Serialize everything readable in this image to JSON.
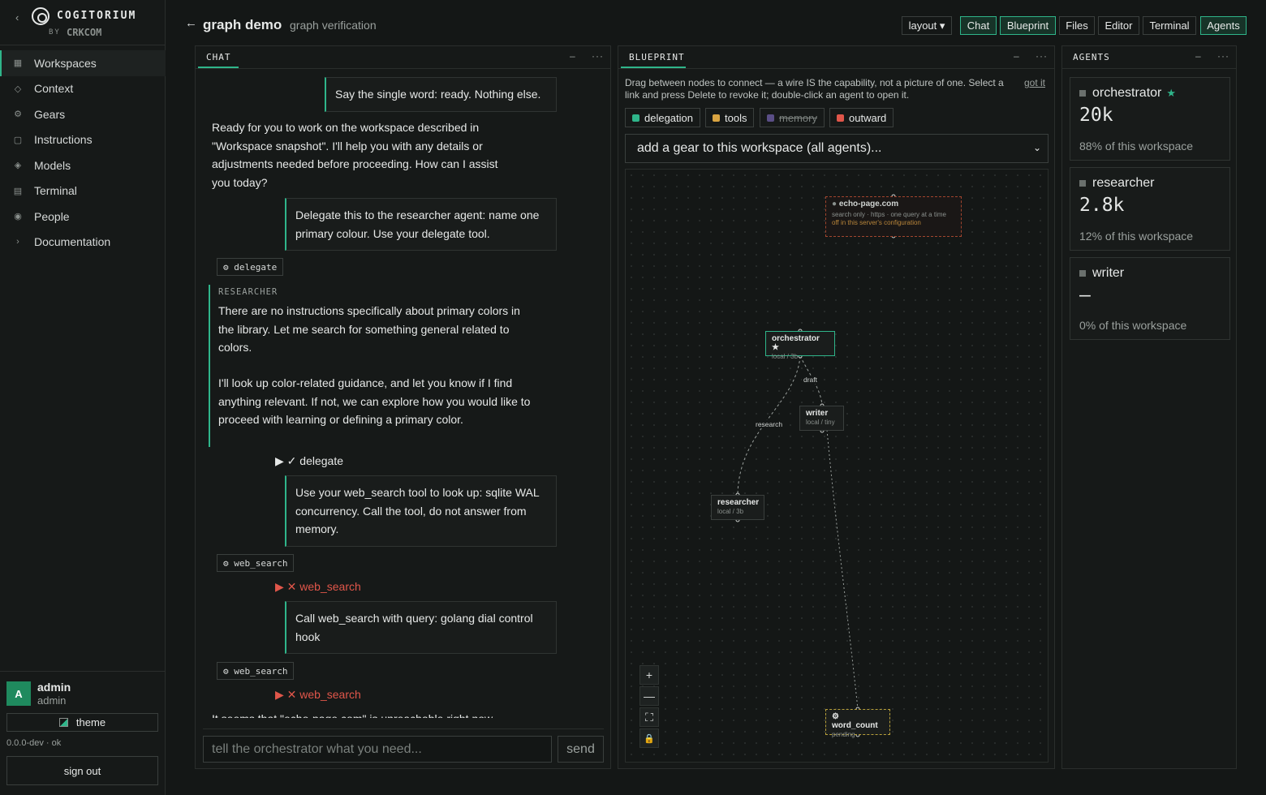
{
  "brand": {
    "name": "COGITORIUM",
    "by": "BY",
    "company": "CRKCOM"
  },
  "nav": [
    {
      "label": "Workspaces",
      "icon": "grid-icon",
      "glyph": "▦",
      "active": true
    },
    {
      "label": "Context",
      "icon": "diamond-outline-icon",
      "glyph": "◇"
    },
    {
      "label": "Gears",
      "icon": "gear-icon",
      "glyph": "⚙"
    },
    {
      "label": "Instructions",
      "icon": "document-icon",
      "glyph": "▢"
    },
    {
      "label": "Models",
      "icon": "diamond-icon",
      "glyph": "◈"
    },
    {
      "label": "Terminal",
      "icon": "terminal-icon",
      "glyph": "▤"
    },
    {
      "label": "People",
      "icon": "person-icon",
      "glyph": "◉"
    },
    {
      "label": "Documentation",
      "icon": "chevron-right-icon",
      "glyph": "›"
    }
  ],
  "user": {
    "initial": "A",
    "name": "admin",
    "role": "admin",
    "theme_label": "theme",
    "version": "0.0.0-dev · ok",
    "signout_label": "sign out"
  },
  "topbar": {
    "title": "graph demo",
    "subtitle": "graph verification",
    "layout_label": "layout ▾",
    "views": [
      "Chat",
      "Blueprint",
      "Files",
      "Editor",
      "Terminal",
      "Agents"
    ]
  },
  "chat": {
    "title": "CHAT",
    "min": "–",
    "more": "···",
    "messages": {
      "u1": "Say the single word: ready. Nothing else.",
      "a1": "Ready for you to work on the workspace described in \"Workspace snapshot\". I'll help you with any details or adjustments needed before proceeding. How can I assist you today?",
      "u2": "Delegate this to the researcher agent: name one primary colour. Use your delegate tool.",
      "tool1": "⚙ delegate",
      "researcher_label": "RESEARCHER",
      "r1": "There are no instructions specifically about primary colors in the library. Let me search for something general related to colors.",
      "r2": "I'll look up color-related guidance, and let you know if I find anything relevant. If not, we can explore how you would like to proceed with learning or defining a primary color.",
      "c1": "▶ ✓ delegate",
      "u3": "Use your web_search tool to look up: sqlite WAL concurrency. Call the tool, do not answer from memory.",
      "tool2": "⚙ web_search",
      "c2": "▶ ✕ web_search",
      "u4": "Call web_search with query: golang dial control hook",
      "tool3": "⚙ web_search",
      "c3": "▶ ✕ web_search",
      "a_tail": "It seems that \"echo-page.com\" is unreachable right now."
    },
    "input_placeholder": "tell the orchestrator what you need...",
    "send_label": "send"
  },
  "blueprint": {
    "title": "BLUEPRINT",
    "min": "–",
    "more": "···",
    "hint": "Drag between nodes to connect — a wire IS the capability, not a picture of one. Select a link and press Delete to revoke it; double-click an agent to open it.",
    "got_it": "got it",
    "filters": [
      {
        "label": "delegation",
        "color": "#2fb58a",
        "on": true
      },
      {
        "label": "tools",
        "color": "#d9a441",
        "on": true
      },
      {
        "label": "memory",
        "color": "#5a4e86",
        "on": false
      },
      {
        "label": "outward",
        "color": "#e0564a",
        "on": true
      }
    ],
    "gear_select": "add a gear to this workspace (all agents)...",
    "nodes": {
      "echo": {
        "title": "echo-page.com",
        "sub1": "search only · https · one query at a time",
        "sub2": "off in this server's configuration"
      },
      "orchestrator": {
        "title": "orchestrator ★",
        "sub": "local / 3b"
      },
      "writer": {
        "title": "writer",
        "sub": "local / tiny"
      },
      "researcher": {
        "title": "researcher",
        "sub": "local / 3b"
      },
      "word_count": {
        "title": "⚙ word_count",
        "sub": "pending"
      }
    },
    "edges": {
      "draft": "draft",
      "research": "research"
    },
    "controls": [
      "+",
      "—",
      "⛶",
      "🔒"
    ]
  },
  "agents": {
    "title": "AGENTS",
    "min": "–",
    "more": "···",
    "list": [
      {
        "name": "orchestrator",
        "star": "★",
        "value": "20k",
        "share": "88% of this workspace"
      },
      {
        "name": "researcher",
        "value": "2.8k",
        "share": "12% of this workspace"
      },
      {
        "name": "writer",
        "value": "—",
        "share": "0% of this workspace"
      }
    ]
  }
}
